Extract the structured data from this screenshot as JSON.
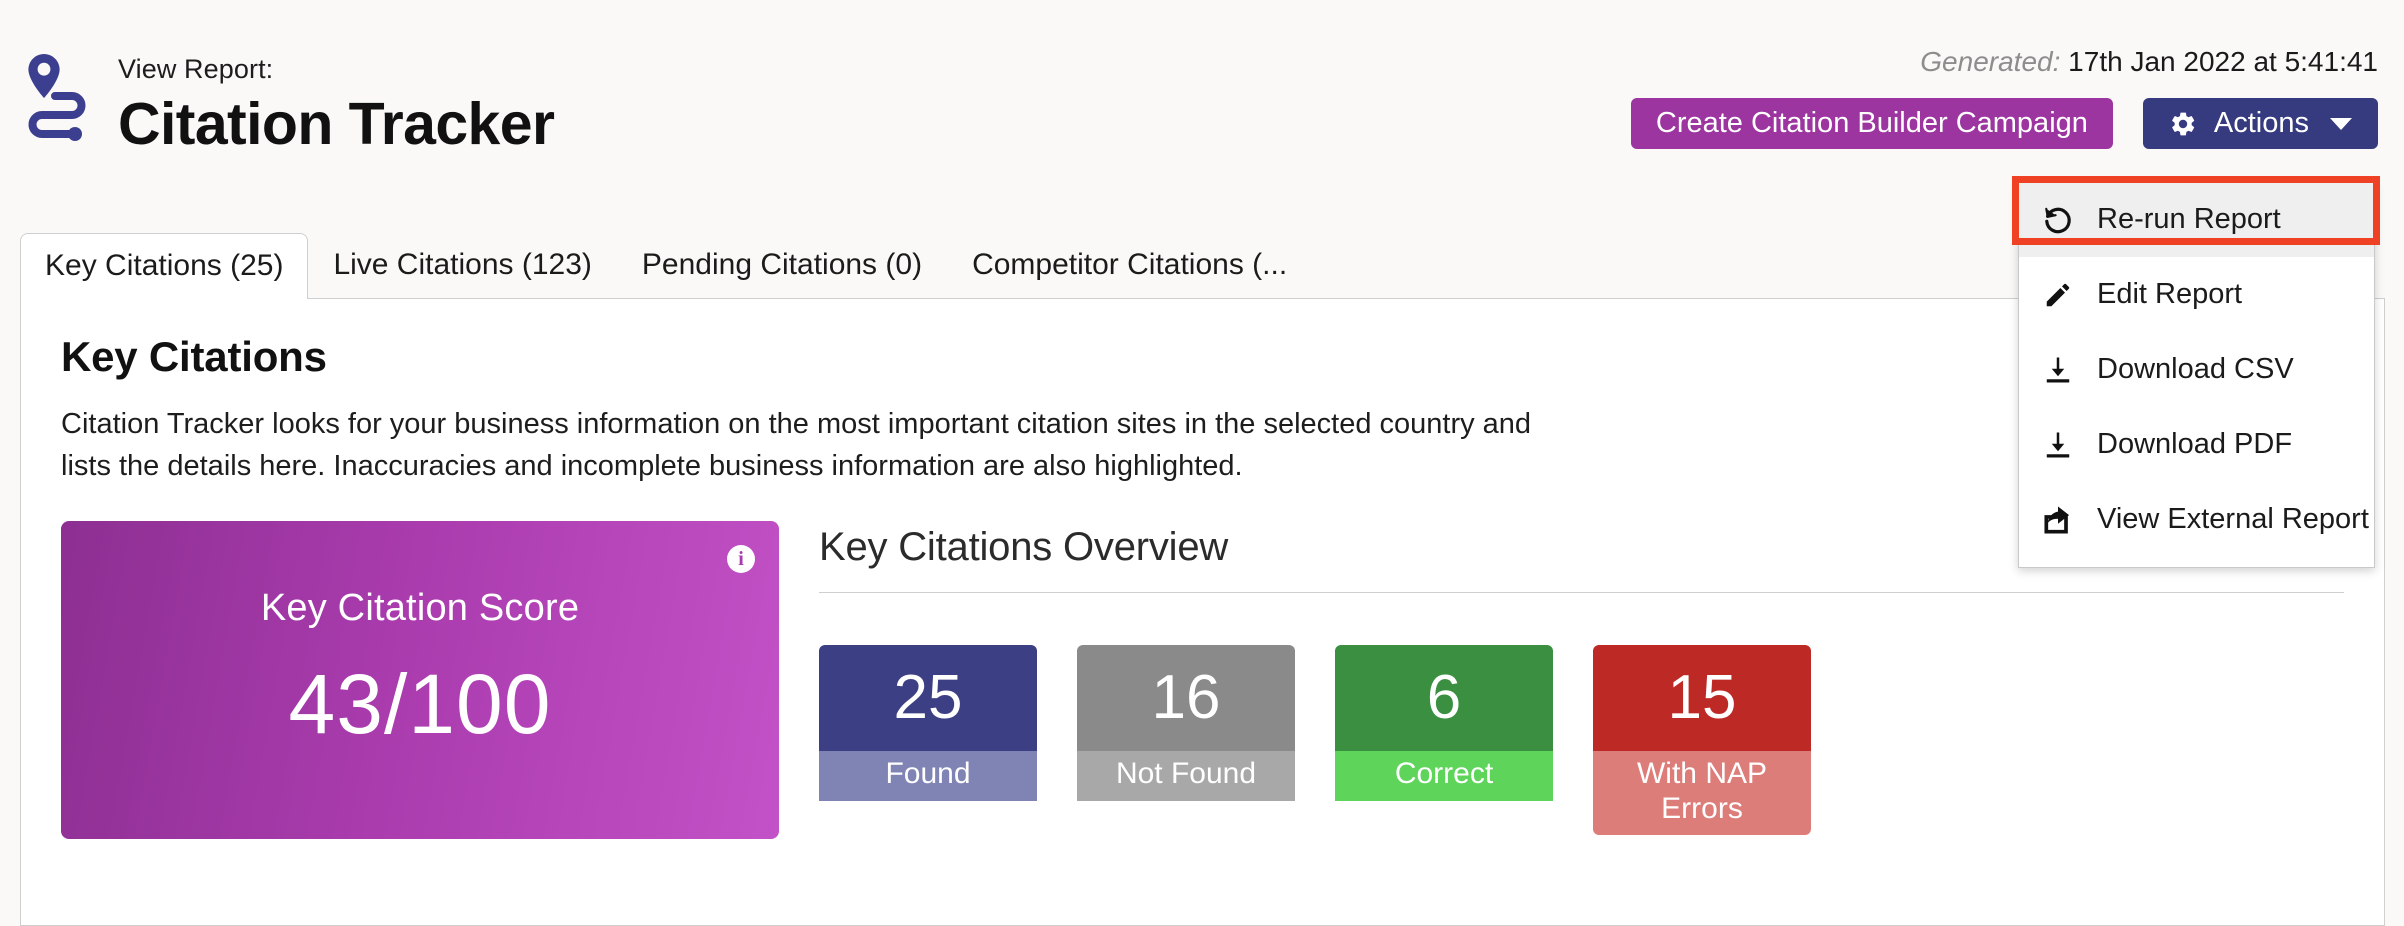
{
  "header": {
    "logo_icon": "location-route-icon",
    "eyebrow": "View Report:",
    "title": "Citation Tracker",
    "generated_label": "Generated:",
    "generated_value": "17th Jan 2022 at 5:41:41",
    "buttons": {
      "campaign_label": "Create Citation Builder Campaign",
      "campaign_color": "#9c35a0",
      "actions_label": "Actions",
      "actions_color": "#363a7f",
      "actions_icon": "gear-icon",
      "actions_caret": "chevron-down-icon"
    }
  },
  "actions_menu": {
    "highlight_color": "#ef4123",
    "items": [
      {
        "label": "Re-run Report",
        "icon": "rerun-undo-icon",
        "highlighted": true
      },
      {
        "label": "Edit Report",
        "icon": "pencil-icon",
        "highlighted": false
      },
      {
        "label": "Download CSV",
        "icon": "download-icon",
        "highlighted": false
      },
      {
        "label": "Download PDF",
        "icon": "download-icon",
        "highlighted": false
      },
      {
        "label": "View External Report",
        "icon": "external-share-icon",
        "highlighted": false
      }
    ]
  },
  "tabs": [
    {
      "label": "Key Citations (25)",
      "active": true
    },
    {
      "label": "Live Citations (123)",
      "active": false
    },
    {
      "label": "Pending Citations (0)",
      "active": false
    },
    {
      "label": "Competitor Citations (...",
      "active": false
    }
  ],
  "main": {
    "heading": "Key Citations",
    "description": "Citation Tracker looks for your business information on the most important citation sites in the selected country and lists the details here. Inaccuracies and incomplete business information are also highlighted.",
    "score_card": {
      "label": "Key Citation Score",
      "value": "43/100",
      "info_glyph": "i",
      "info_icon": "info-icon"
    },
    "overview": {
      "title": "Key Citations Overview",
      "stats": [
        {
          "value": "25",
          "label": "Found",
          "top_color": "#3c3f84",
          "bottom_color": "#8084b5"
        },
        {
          "value": "16",
          "label": "Not Found",
          "top_color": "#8a8a8a",
          "bottom_color": "#a8a8a8"
        },
        {
          "value": "6",
          "label": "Correct",
          "top_color": "#3a9040",
          "bottom_color": "#5ed45a"
        },
        {
          "value": "15",
          "label": "With NAP Errors",
          "top_color": "#bd2a26",
          "bottom_color": "#dd7d79"
        }
      ]
    }
  },
  "chart_data": {
    "type": "bar",
    "title": "Key Citations Overview",
    "categories": [
      "Found",
      "Not Found",
      "Correct",
      "With NAP Errors"
    ],
    "values": [
      25,
      16,
      6,
      15
    ],
    "xlabel": "",
    "ylabel": "",
    "score": 43,
    "score_max": 100
  }
}
